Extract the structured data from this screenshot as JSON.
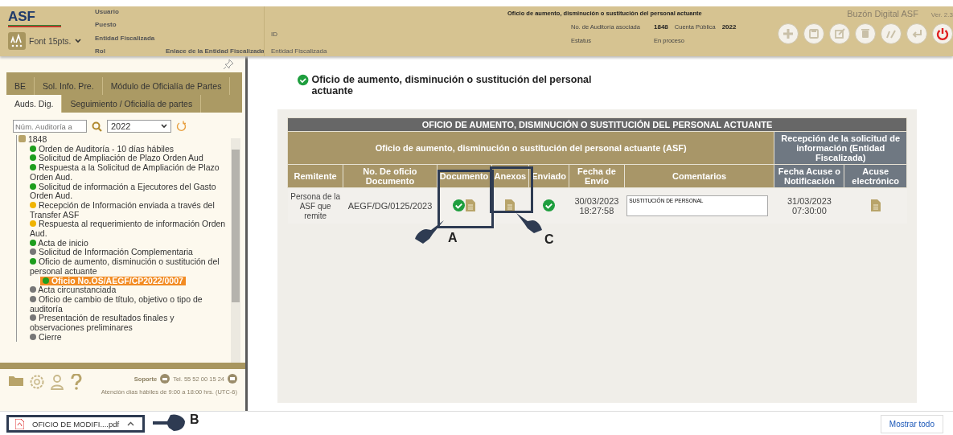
{
  "header": {
    "logo": "ASF",
    "font_selector": "Font 15pts.",
    "user_fields": [
      {
        "label": "Usuario"
      },
      {
        "label": "Puesto"
      },
      {
        "label": "Entidad Fiscalizada"
      },
      {
        "label": "Rol",
        "value": "Enlace de la Entidad Fiscalizada"
      }
    ],
    "id_label": "ID",
    "entity_label": "Entidad Fiscalizada",
    "doc_title": "Oficio de aumento, disminución o sustitución del personal actuante",
    "audit_label": "No. de Auditoría asociada",
    "audit_value": "1848",
    "account_label": "Cuenta Pública",
    "account_value": "2022",
    "status_label": "Estatus",
    "status_value": "En proceso",
    "brand": "Buzón Digital ASF",
    "version": "Ver. 2.3",
    "toolbar": [
      {
        "kind": "add"
      },
      {
        "kind": "save"
      },
      {
        "kind": "edit"
      },
      {
        "kind": "delete"
      },
      {
        "kind": "sign"
      },
      {
        "kind": "return"
      },
      {
        "kind": "power"
      }
    ]
  },
  "sidebar": {
    "tab_rows": [
      [
        {
          "label": "BE",
          "selected": false
        },
        {
          "label": "Sol. Info. Pre.",
          "selected": false
        },
        {
          "label": "Módulo de Oficialía de Partes",
          "selected": false
        }
      ],
      [
        {
          "label": "Auds. Dig.",
          "selected": true
        },
        {
          "label": "Seguimiento / Oficialía de partes",
          "selected": false
        }
      ]
    ],
    "search": {
      "placeholder": "Núm. Auditoría a"
    },
    "year": "2022",
    "tree": [
      {
        "kind": "folder",
        "label": "1848",
        "selected": false,
        "children": [
          {
            "kind": "status",
            "label": "Orden de Auditoría - 10 días hábiles",
            "color": "#1e9e1e",
            "selected": false
          },
          {
            "kind": "status",
            "label": "Solicitud de Ampliación de Plazo Orden Aud",
            "color": "#1e9e1e",
            "selected": false
          },
          {
            "kind": "status",
            "label": "Respuesta a la Solicitud de Ampliación de Plazo Orden Aud.",
            "color": "#1e9e1e",
            "selected": false
          },
          {
            "kind": "status",
            "label": "Solicitud de información a Ejecutores del Gasto Orden Aud.",
            "color": "#1e9e1e",
            "selected": false
          },
          {
            "kind": "status",
            "label": "Recepción de Información enviada a través del Transfer ASF",
            "color": "#f0b400",
            "selected": false
          },
          {
            "kind": "status",
            "label": "Respuesta al requerimiento de información Orden Aud.",
            "color": "#f0b400",
            "selected": false
          },
          {
            "kind": "status",
            "label": "Acta de inicio",
            "color": "#1e9e1e",
            "selected": false
          },
          {
            "kind": "status",
            "label": "Solicitud de Información Complementaria",
            "color": "#777777",
            "selected": false
          },
          {
            "kind": "status",
            "label": "Oficio de aumento, disminución o sustitución del personal actuante",
            "color": "#1e9e1e",
            "selected": false,
            "children": [
              {
                "kind": "status",
                "label": "Oficio No.OS/AEGF/CP2022/0007",
                "color": "#1e9e1e",
                "selected": true
              }
            ]
          },
          {
            "kind": "status",
            "label": "Acta circunstanciada",
            "color": "#777777",
            "selected": false
          },
          {
            "kind": "status",
            "label": "Oficio de cambio de título, objetivo o tipo de auditoría",
            "color": "#777777",
            "selected": false
          },
          {
            "kind": "status",
            "label": "Presentación de resultados finales y observaciones preliminares",
            "color": "#777777",
            "selected": false
          },
          {
            "kind": "status",
            "label": "Cierre",
            "color": "#777777",
            "selected": false
          }
        ]
      }
    ],
    "support_label": "Soporte",
    "phone": "Tel. 55 52 00 15 24",
    "hours": "Atención días hábiles de 9:00 a 18:00 hrs. (UTC-6)"
  },
  "main": {
    "title": "Oficio de aumento, disminución o sustitución del personal actuante",
    "table": {
      "title": "OFICIO DE AUMENTO, DISMINUCIÓN O SUSTITUCIÓN DEL PERSONAL ACTUANTE",
      "group_asf": "Oficio de aumento, disminución o sustitución del personal actuante (ASF)",
      "group_entity": "Recepción de la solicitud de información (Entidad Fiscalizada)",
      "columns": [
        "Remitente",
        "No. De oficio Documento",
        "Documento",
        "Anexos",
        "Enviado",
        "Fecha de Envío",
        "Comentarios",
        "Fecha Acuse o Notificación",
        "Acuse electrónico"
      ],
      "rows": [
        [
          {
            "kind": "text",
            "text": "Persona de la ASF que remite"
          },
          {
            "kind": "text",
            "text": "AEGF/DG/0125/2023"
          },
          {
            "kind": "file",
            "checked": true
          },
          {
            "kind": "file",
            "checked": false
          },
          {
            "kind": "check"
          },
          {
            "kind": "text",
            "text": "30/03/2023 18:27:58"
          },
          {
            "kind": "comment",
            "text": "SUSTITUCIÓN DE PERSONAL"
          },
          {
            "kind": "text",
            "text": "31/03/2023 07:30:00"
          },
          {
            "kind": "file",
            "checked": false
          }
        ]
      ]
    }
  },
  "annotations": [
    {
      "label": "A"
    },
    {
      "label": "C"
    },
    {
      "label": "B"
    }
  ],
  "downloads": {
    "file": "OFICIO DE MODIFI....pdf",
    "show_all": "Mostrar todo"
  }
}
